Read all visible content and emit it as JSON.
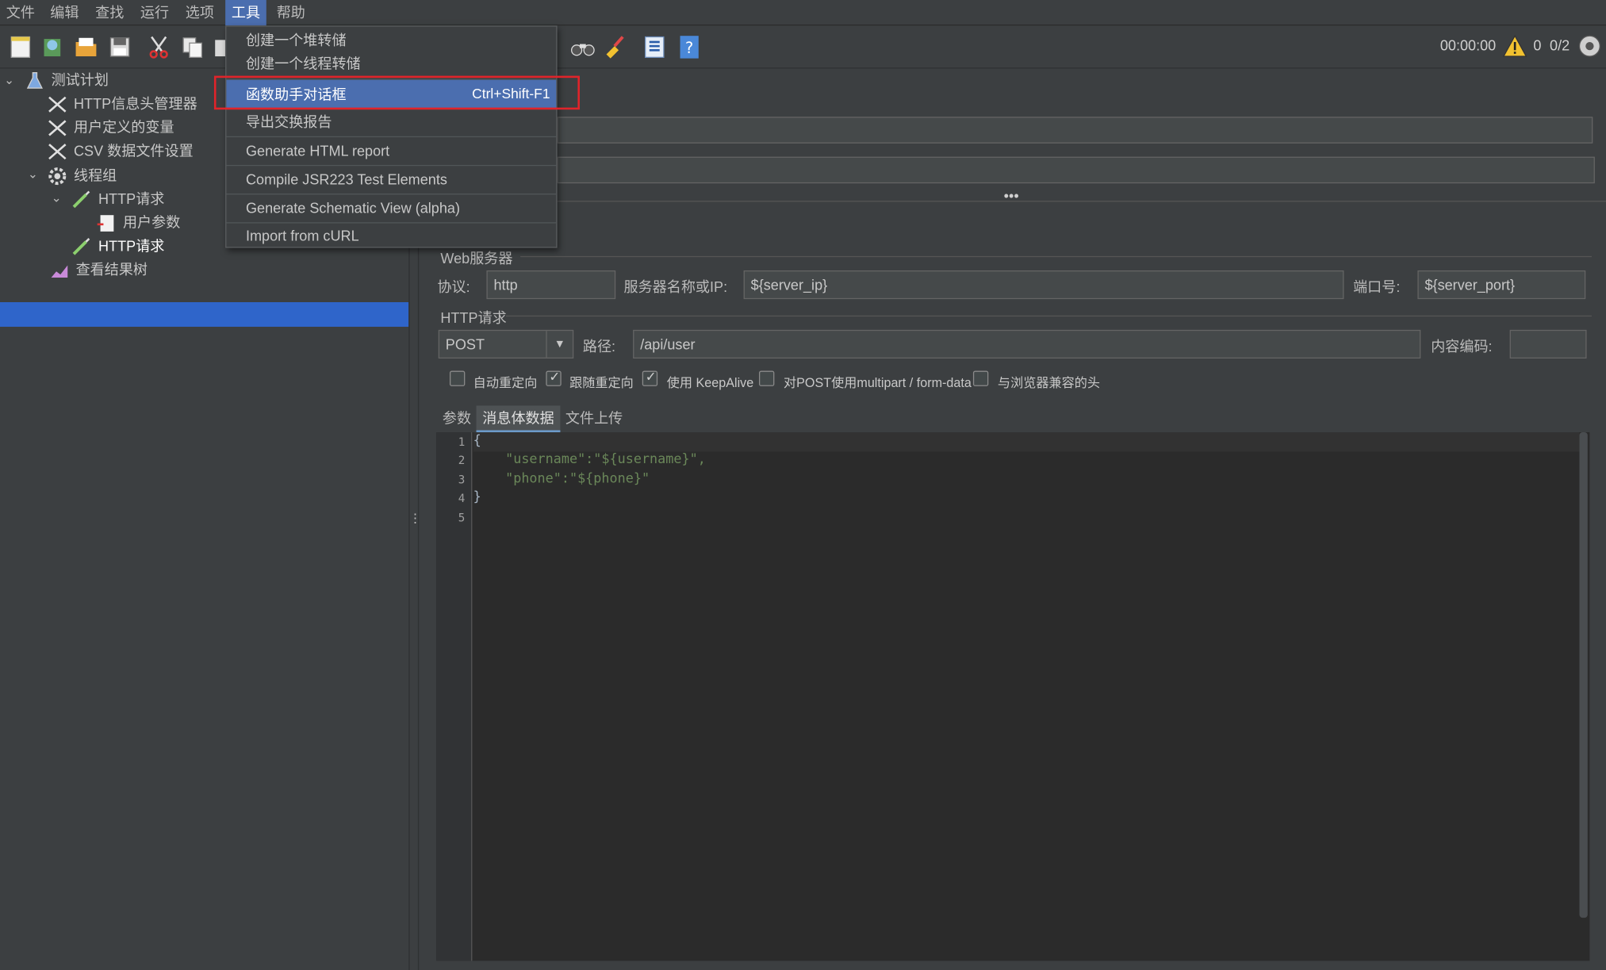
{
  "menubar": {
    "items": [
      "文件",
      "编辑",
      "查找",
      "运行",
      "选项",
      "工具",
      "帮助"
    ],
    "active": "工具"
  },
  "toolbar": {
    "timer": "00:00:00",
    "warnings": "0",
    "threads": "0/2"
  },
  "tree": {
    "items": [
      {
        "label": "测试计划",
        "icon": "flask-icon"
      },
      {
        "label": "HTTP信息头管理器",
        "icon": "wrench-icon"
      },
      {
        "label": "用户定义的变量",
        "icon": "wrench-icon"
      },
      {
        "label": "CSV 数据文件设置",
        "icon": "wrench-icon"
      },
      {
        "label": "线程组",
        "icon": "gear-icon"
      },
      {
        "label": "HTTP请求",
        "icon": "pipette-icon"
      },
      {
        "label": "用户参数",
        "icon": "document-icon"
      },
      {
        "label": "HTTP请求",
        "icon": "pipette-icon",
        "selected": true
      },
      {
        "label": "查看结果树",
        "icon": "chart-icon"
      }
    ]
  },
  "tools_menu": {
    "items": [
      {
        "label": "创建一个堆转储"
      },
      {
        "label": "创建一个线程转储"
      },
      {
        "label": "函数助手对话框",
        "shortcut": "Ctrl+Shift-F1",
        "highlighted": true
      },
      {
        "label": "导出交换报告"
      },
      {
        "label": "Generate HTML report"
      },
      {
        "label": "Compile JSR223 Test Elements"
      },
      {
        "label": "Generate Schematic View (alpha)"
      },
      {
        "label": "Import from cURL"
      }
    ]
  },
  "web_server": {
    "section_title": "Web服务器",
    "protocol_label": "协议:",
    "protocol_value": "http",
    "server_label": "服务器名称或IP:",
    "server_value": "${server_ip}",
    "port_label": "端口号:",
    "port_value": "${server_port}"
  },
  "http_request": {
    "section_title": "HTTP请求",
    "method": "POST",
    "path_label": "路径:",
    "path_value": "/api/user",
    "encoding_label": "内容编码:",
    "encoding_value": ""
  },
  "options": [
    {
      "label": "自动重定向",
      "checked": false
    },
    {
      "label": "跟随重定向",
      "checked": true
    },
    {
      "label": "使用 KeepAlive",
      "checked": true
    },
    {
      "label": "对POST使用multipart / form-data",
      "checked": false
    },
    {
      "label": "与浏览器兼容的头",
      "checked": false
    }
  ],
  "tabs": [
    {
      "label": "参数",
      "active": false
    },
    {
      "label": "消息体数据",
      "active": true
    },
    {
      "label": "文件上传",
      "active": false
    }
  ],
  "body_editor": {
    "line_numbers": [
      "1",
      "2",
      "3",
      "4",
      "5"
    ],
    "lines": [
      "{",
      "    \"username\":\"${username}\",",
      "    \"phone\":\"${phone}\"",
      "}",
      ""
    ]
  },
  "colors": {
    "background": "#3c3f41",
    "selection": "#2f65ca",
    "menu_highlight": "#4b6eaf",
    "annotation_red": "#e0242a",
    "json_string": "#6a8759"
  }
}
